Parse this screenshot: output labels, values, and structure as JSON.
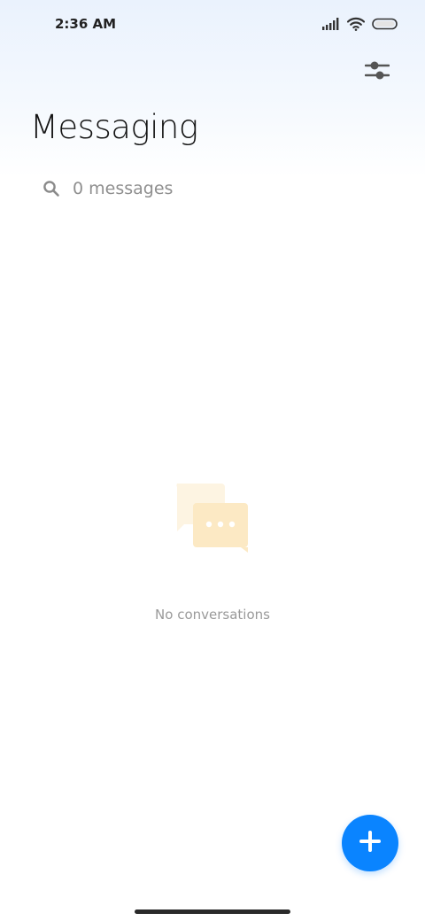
{
  "status_bar": {
    "time": "2:36 AM",
    "icons": [
      "signal-icon",
      "wifi-icon",
      "battery-icon"
    ]
  },
  "header": {
    "title": "Messaging",
    "filter_icon": "sliders-icon"
  },
  "search": {
    "placeholder": "0 messages",
    "icon": "search-icon"
  },
  "empty_state": {
    "icon": "chat-bubbles-icon",
    "text": "No conversations"
  },
  "fab": {
    "icon": "plus-icon"
  },
  "colors": {
    "accent": "#0a84ff",
    "bubble_back": "#fdf4e2",
    "bubble_front": "#fce9c4"
  }
}
